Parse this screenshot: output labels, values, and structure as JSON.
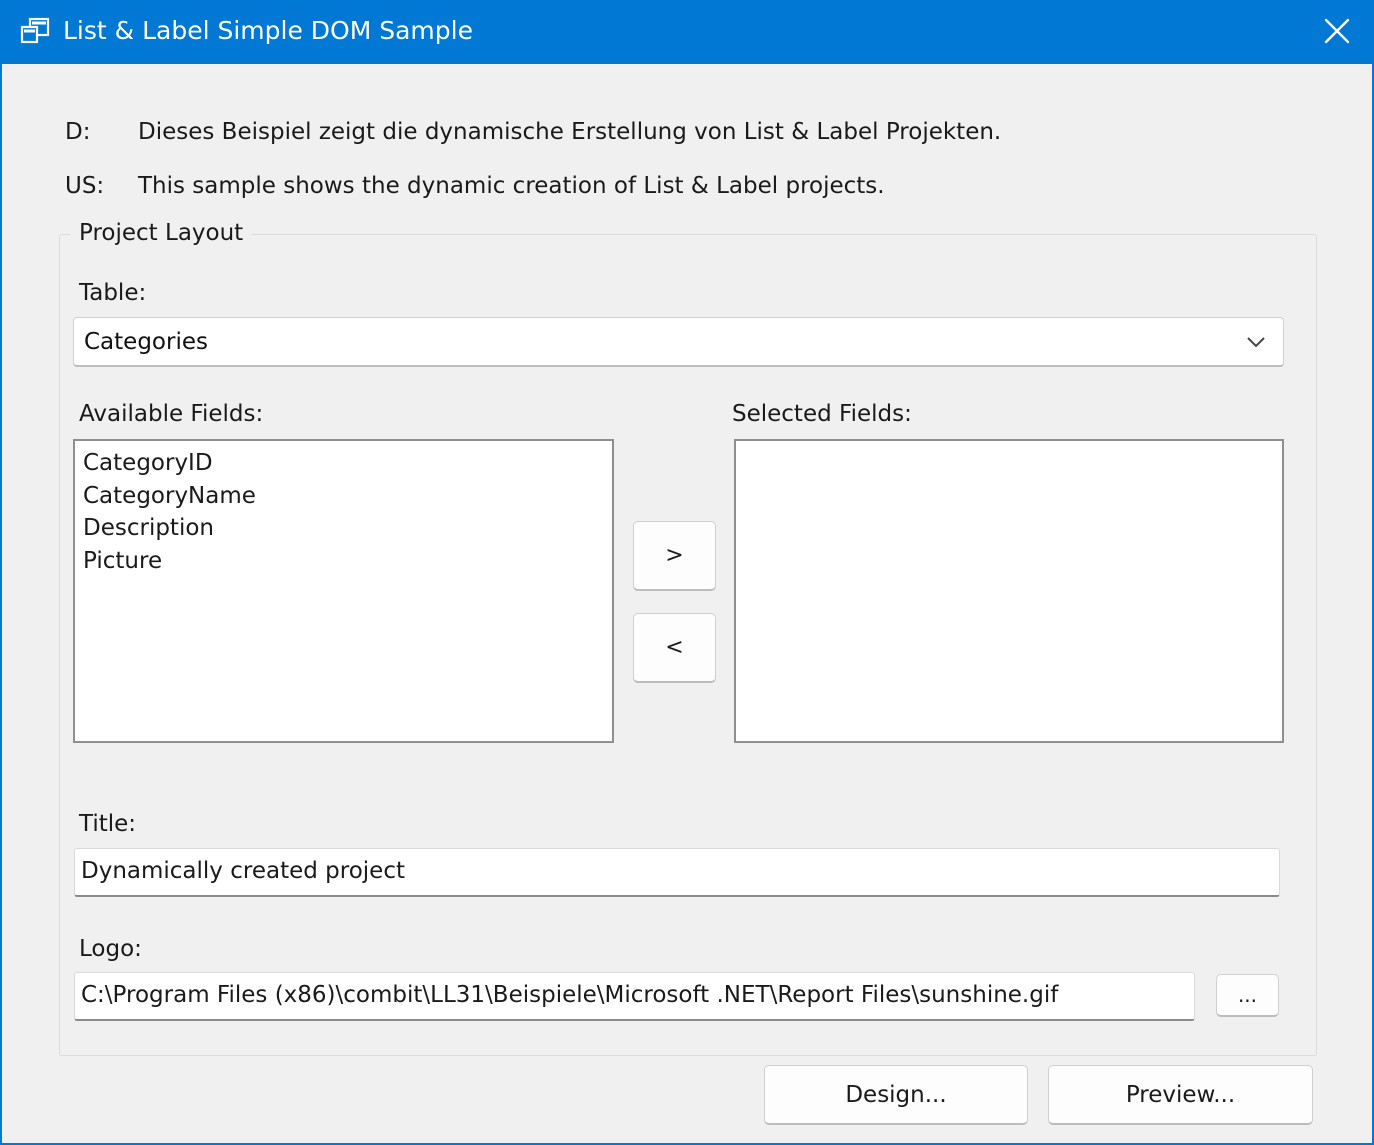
{
  "window": {
    "title": "List & Label Simple DOM Sample",
    "accent_color": "#0078d4",
    "app_icon": "window-icon",
    "close_icon": "close-icon"
  },
  "description": {
    "de_prefix": "D:",
    "de_text": "Dieses Beispiel zeigt die dynamische Erstellung von List & Label Projekten.",
    "us_prefix": "US:",
    "us_text": "This sample shows the dynamic creation of List & Label projects."
  },
  "project_layout": {
    "group_label": "Project Layout",
    "table_label": "Table:",
    "table_value": "Categories",
    "available_label": "Available Fields:",
    "available_fields": [
      "CategoryID",
      "CategoryName",
      "Description",
      "Picture"
    ],
    "selected_label": "Selected Fields:",
    "selected_fields": [],
    "add_button": ">",
    "remove_button": "<",
    "title_label": "Title:",
    "title_value": "Dynamically created project",
    "logo_label": "Logo:",
    "logo_value": "C:\\Program Files (x86)\\combit\\LL31\\Beispiele\\Microsoft .NET\\Report Files\\sunshine.gif",
    "browse_button": "..."
  },
  "footer": {
    "design_button": "Design...",
    "preview_button": "Preview..."
  }
}
